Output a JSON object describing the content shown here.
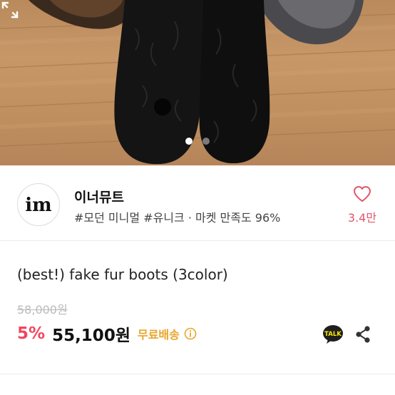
{
  "gallery": {
    "slide_count": 2,
    "active_slide": 1
  },
  "shop": {
    "logo_text": "im",
    "name": "이너뮤트",
    "tags": "#모던 미니멀 #유니크 · 마켓 만족도 96%",
    "like_count": "3.4만",
    "like_color": "#e0576b"
  },
  "product": {
    "title": "(best!) fake fur boots (3color)",
    "original_price": "58,000원",
    "discount": "5%",
    "price": "55,100원",
    "shipping": "무료배송",
    "discount_color": "#f3455f",
    "shipping_color": "#e8a52a"
  },
  "actions": {
    "talk_label": "TALK"
  },
  "icons": [
    "expand-icon",
    "heart-icon",
    "info-icon",
    "kakao-talk-icon",
    "share-icon"
  ]
}
